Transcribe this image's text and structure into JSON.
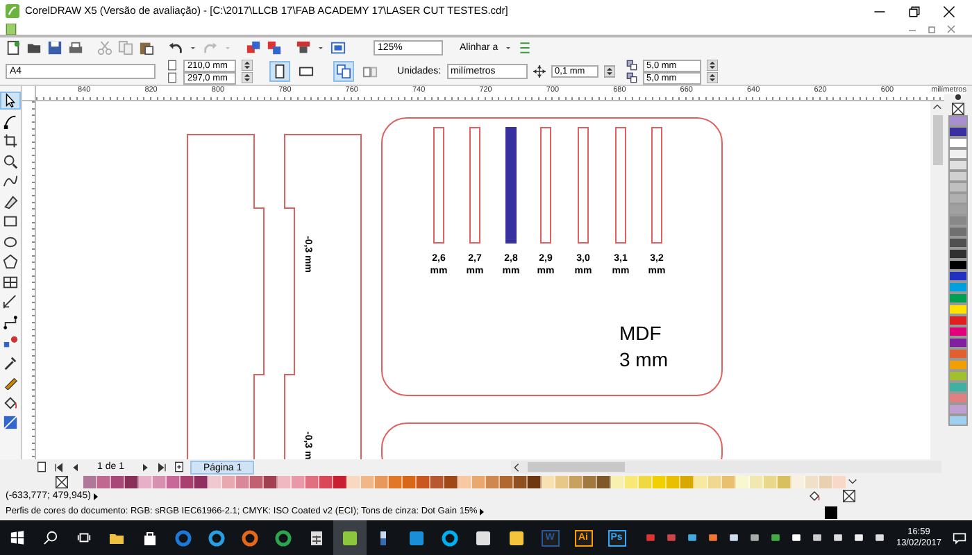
{
  "window": {
    "title": "CorelDRAW X5 (Versão de avaliação) - [C:\\2017\\LLCB 17\\FAB ACADEMY 17\\LASER CUT TESTES.cdr]"
  },
  "toolbar": {
    "zoom": "125%",
    "snap": "Alinhar a"
  },
  "property_bar": {
    "page_size": "A4",
    "width": "210,0 mm",
    "height": "297,0 mm",
    "orientation": [
      {
        "kind": "portrait",
        "selected": true
      },
      {
        "kind": "landscape",
        "selected": false
      }
    ],
    "pages": [
      {
        "kind": "all",
        "selected": true
      },
      {
        "kind": "current",
        "selected": false
      }
    ],
    "units_label": "Unidades:",
    "units": "milímetros",
    "nudge": "0,1 mm",
    "dup_x": "5,0 mm",
    "dup_y": "5,0 mm"
  },
  "toolbox": {
    "tools": [
      {
        "kind": "pointer",
        "selected": true
      },
      {
        "kind": "node",
        "selected": false
      },
      {
        "kind": "crop",
        "selected": false
      },
      {
        "kind": "zoom",
        "selected": false
      },
      {
        "kind": "freehand",
        "selected": false
      },
      {
        "kind": "smartfill",
        "selected": false
      },
      {
        "kind": "rectangle",
        "selected": false
      },
      {
        "kind": "ellipse",
        "selected": false
      },
      {
        "kind": "polygon",
        "selected": false
      },
      {
        "kind": "table",
        "selected": false
      },
      {
        "kind": "dimension",
        "selected": false
      },
      {
        "kind": "connector",
        "selected": false
      },
      {
        "kind": "blend",
        "selected": false
      },
      {
        "kind": "eyedropper",
        "selected": false
      },
      {
        "kind": "outline",
        "selected": false
      },
      {
        "kind": "fill",
        "selected": false
      },
      {
        "kind": "interactive",
        "selected": false
      }
    ]
  },
  "ruler": {
    "labels": [
      "840",
      "820",
      "800",
      "780",
      "760",
      "740",
      "720",
      "700",
      "680",
      "660",
      "640",
      "620",
      "600"
    ],
    "unit": "milímetros"
  },
  "canvas": {
    "strips": [
      {
        "label": "2,6 mm",
        "selected": false
      },
      {
        "label": "2,7 mm",
        "selected": false
      },
      {
        "label": "2,8 mm",
        "selected": true
      },
      {
        "label": "2,9 mm",
        "selected": false
      },
      {
        "label": "3,0 mm",
        "selected": false
      },
      {
        "label": "3,1 mm",
        "selected": false
      },
      {
        "label": "3,2 mm",
        "selected": false
      }
    ],
    "offset_labels": [
      "-0,3 mm",
      "-0,3 m"
    ],
    "material": "MDF",
    "thickness": "3 mm"
  },
  "page_nav": {
    "count": "1 de 1",
    "tab": "Página 1"
  },
  "palette_bottom": [
    {
      "color": "#b07898"
    },
    {
      "color": "#c06890"
    },
    {
      "color": "#a84878"
    },
    {
      "color": "#883058"
    },
    {
      "color": "#e8b0c8"
    },
    {
      "color": "#d890b0"
    },
    {
      "color": "#c86898"
    },
    {
      "color": "#a84070"
    },
    {
      "color": "#903060"
    },
    {
      "color": "#f0c8d0"
    },
    {
      "color": "#e8a8b0"
    },
    {
      "color": "#d88898"
    },
    {
      "color": "#c06070"
    },
    {
      "color": "#a04050"
    },
    {
      "color": "#f0b8c0"
    },
    {
      "color": "#e898a8"
    },
    {
      "color": "#e07080"
    },
    {
      "color": "#d84858"
    },
    {
      "color": "#c82030"
    },
    {
      "color": "#f8d8c0"
    },
    {
      "color": "#f0b888"
    },
    {
      "color": "#e89858"
    },
    {
      "color": "#e07828"
    },
    {
      "color": "#d86818"
    },
    {
      "color": "#c85820"
    },
    {
      "color": "#b85830"
    },
    {
      "color": "#a04818"
    },
    {
      "color": "#f8c8a0"
    },
    {
      "color": "#e8a870"
    },
    {
      "color": "#d08850"
    },
    {
      "color": "#b06830"
    },
    {
      "color": "#905020"
    },
    {
      "color": "#703810"
    },
    {
      "color": "#f8e0b0"
    },
    {
      "color": "#e8c888"
    },
    {
      "color": "#c8a060"
    },
    {
      "color": "#a07840"
    },
    {
      "color": "#805828"
    },
    {
      "color": "#f8f0b0"
    },
    {
      "color": "#f8e878"
    },
    {
      "color": "#f0d840"
    },
    {
      "color": "#f0d000"
    },
    {
      "color": "#e8c000"
    },
    {
      "color": "#d8a800"
    },
    {
      "color": "#f8e8a0"
    },
    {
      "color": "#f0d890"
    },
    {
      "color": "#e8c070"
    },
    {
      "color": "#f8f8d0"
    },
    {
      "color": "#f0e8b0"
    },
    {
      "color": "#e8d888"
    },
    {
      "color": "#d8c060"
    },
    {
      "color": "#f8f0e0"
    },
    {
      "color": "#f0e0c8"
    },
    {
      "color": "#e8d0b0"
    },
    {
      "color": "#f8d8c8"
    }
  ],
  "palette_side": [
    {
      "color": "#a890d0"
    },
    {
      "color": "#3a2f9f"
    },
    {
      "color": "#ffffff"
    },
    {
      "color": "#f0f0f0"
    },
    {
      "color": "#e0e0e0"
    },
    {
      "color": "#d0d0d0"
    },
    {
      "color": "#c0c0c0"
    },
    {
      "color": "#b0b0b0"
    },
    {
      "color": "#a0a0a0"
    },
    {
      "color": "#888888"
    },
    {
      "color": "#707070"
    },
    {
      "color": "#505050"
    },
    {
      "color": "#303030"
    },
    {
      "color": "#000000"
    },
    {
      "color": "#2030c0"
    },
    {
      "color": "#00a0e0"
    },
    {
      "color": "#00a050"
    },
    {
      "color": "#ffe000"
    },
    {
      "color": "#e02020"
    },
    {
      "color": "#e0007a"
    },
    {
      "color": "#8020a0"
    },
    {
      "color": "#e06030"
    },
    {
      "color": "#f0a000"
    },
    {
      "color": "#a0c030"
    },
    {
      "color": "#40b0a0"
    },
    {
      "color": "#e08080"
    },
    {
      "color": "#c0a0d0"
    },
    {
      "color": "#a0d0f0"
    }
  ],
  "status": {
    "coords": "(-633,777; 479,945)",
    "profile": "Perfis de cores do documento: RGB: sRGB IEC61966-2.1; CMYK: ISO Coated v2 (ECI); Tons de cinza: Dot Gain 15%"
  },
  "taskbar": {
    "apps": [
      {
        "kind": "folder",
        "selected": false
      },
      {
        "kind": "bag",
        "selected": false
      },
      {
        "kind": "ring",
        "color": "#1e78d7",
        "selected": false
      },
      {
        "kind": "ring",
        "color": "#2a9fe0",
        "selected": false
      },
      {
        "kind": "ring",
        "color": "#e8661a",
        "selected": false
      },
      {
        "kind": "ring",
        "color": "#2ea44f",
        "selected": false
      },
      {
        "kind": "calculator",
        "selected": false
      },
      {
        "kind": "square",
        "color": "#8cc63f",
        "selected": true
      },
      {
        "kind": "bottle",
        "selected": false
      },
      {
        "kind": "square",
        "color": "#1b8fd6",
        "selected": false
      },
      {
        "kind": "ring",
        "color": "#00aff0",
        "selected": false
      },
      {
        "kind": "square",
        "color": "#e0e0e0",
        "selected": false
      },
      {
        "kind": "square",
        "color": "#f2c53d",
        "selected": false
      },
      {
        "kind": "letter",
        "label": "W",
        "color": "#2b579a",
        "selected": false
      },
      {
        "kind": "letter",
        "label": "Ai",
        "color": "#ff9a00",
        "selected": false
      },
      {
        "kind": "letter",
        "label": "Ps",
        "color": "#31a8ff",
        "selected": false
      }
    ],
    "time": "16:59",
    "date": "13/02/2017"
  }
}
